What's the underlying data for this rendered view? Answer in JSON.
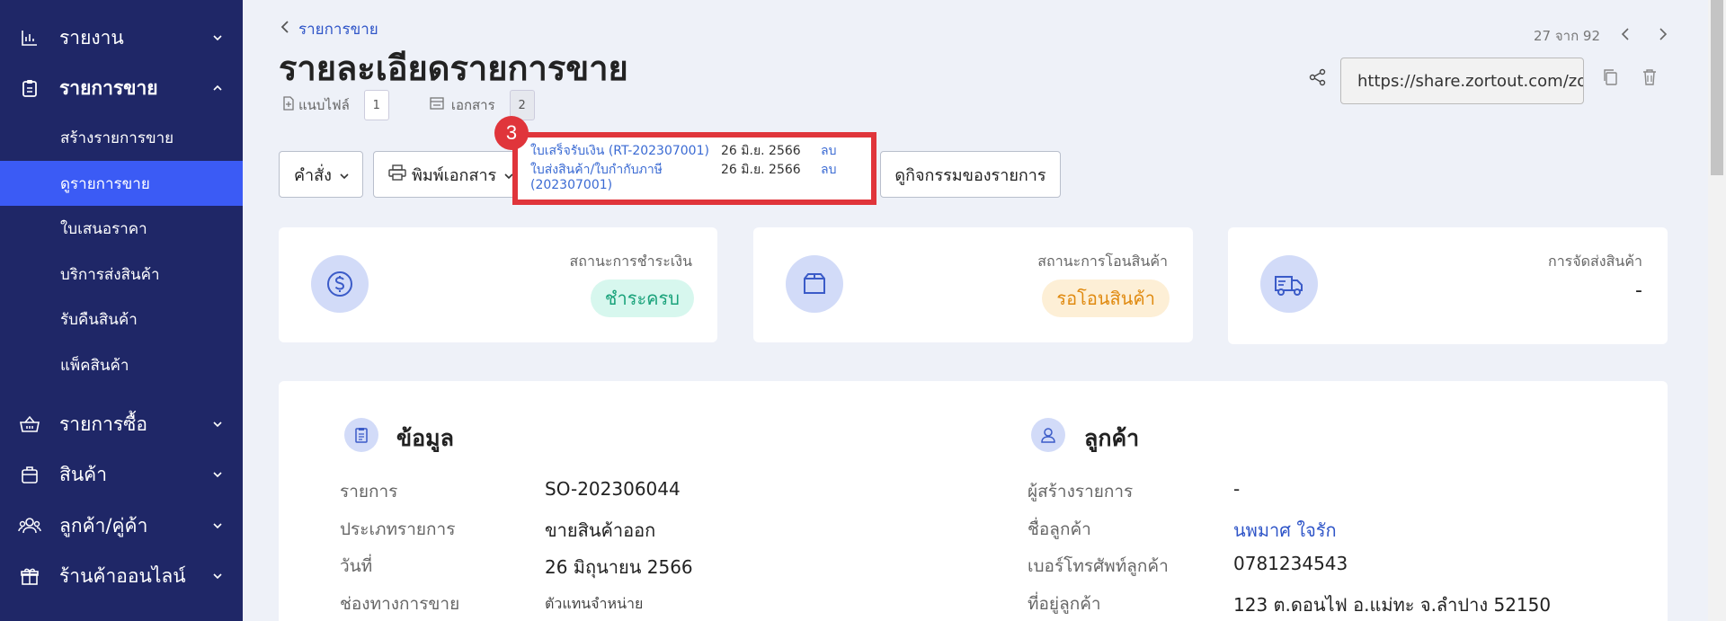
{
  "sidebar": {
    "items": [
      {
        "label": "รายงาน",
        "icon": "bar-chart-icon"
      },
      {
        "label": "รายการขาย",
        "icon": "clipboard-icon"
      },
      {
        "label": "รายการซื้อ",
        "icon": "basket-icon"
      },
      {
        "label": "สินค้า",
        "icon": "bag-icon"
      },
      {
        "label": "ลูกค้า/คู่ค้า",
        "icon": "users-icon"
      },
      {
        "label": "ร้านค้าออนไลน์",
        "icon": "gift-shop-icon"
      }
    ],
    "sub_items": [
      {
        "label": "สร้างรายการขาย"
      },
      {
        "label": "ดูรายการขาย",
        "active": true
      },
      {
        "label": "ใบเสนอราคา"
      },
      {
        "label": "บริการส่งสินค้า"
      },
      {
        "label": "รับคืนสินค้า"
      },
      {
        "label": "แพ็คสินค้า"
      }
    ]
  },
  "header": {
    "back_label": "รายการขาย",
    "title": "รายละเอียดรายการขาย",
    "attachments_label": "แนบไฟล์",
    "attachments_count": "1",
    "documents_label": "เอกสาร",
    "documents_count": "2",
    "pager_text": "27 จาก 92",
    "share_url": "https://share.zortout.com/zo"
  },
  "toolbar": {
    "command_label": "คำสั่ง",
    "print_label": "พิมพ์เอกสาร",
    "activity_label": "ดูกิจกรรมของรายการ"
  },
  "popup": {
    "step_number": "3",
    "rows": [
      {
        "name": "ใบเสร็จรับเงิน (RT-202307001)",
        "date": "26 มิ.ย. 2566",
        "delete": "ลบ"
      },
      {
        "name_line1": "ใบส่งสินค้า/ใบกำกับภาษี",
        "name_line2": "(202307001)",
        "date": "26 มิ.ย. 2566",
        "delete": "ลบ"
      }
    ]
  },
  "cards": [
    {
      "title": "สถานะการชำระเงิน",
      "status": "ชำระครบ",
      "icon": "dollar-icon",
      "color": "#19a27a"
    },
    {
      "title": "สถานะการโอนสินค้า",
      "status": "รอโอนสินค้า",
      "icon": "box-icon",
      "color": "#e08a10"
    },
    {
      "title": "การจัดส่งสินค้า",
      "status": "-",
      "icon": "truck-icon"
    }
  ],
  "info": {
    "title": "ข้อมูล",
    "rows": [
      {
        "label": "รายการ",
        "value": "SO-202306044"
      },
      {
        "label": "ประเภทรายการ",
        "value": "ขายสินค้าออก"
      },
      {
        "label": "วันที่",
        "value": "26 มิถุนายน 2566"
      },
      {
        "label": "ช่องทางการขาย",
        "value": "ตัวแทนจำหน่าย"
      }
    ]
  },
  "customer": {
    "title": "ลูกค้า",
    "rows": [
      {
        "label": "ผู้สร้างรายการ",
        "value": "-"
      },
      {
        "label": "ชื่อลูกค้า",
        "value": "นพมาศ ใจรัก"
      },
      {
        "label": "เบอร์โทรศัพท์ลูกค้า",
        "value": "0781234543"
      },
      {
        "label": "ที่อยู่ลูกค้า",
        "value": "123 ต.ดอนไฟ อ.แม่ทะ จ.ลำปาง 52150"
      }
    ]
  },
  "colors": {
    "sidebar_bg": "#1f2767",
    "active_item": "#3b5bf5",
    "link": "#2f55c8",
    "highlight": "#e0353b"
  }
}
